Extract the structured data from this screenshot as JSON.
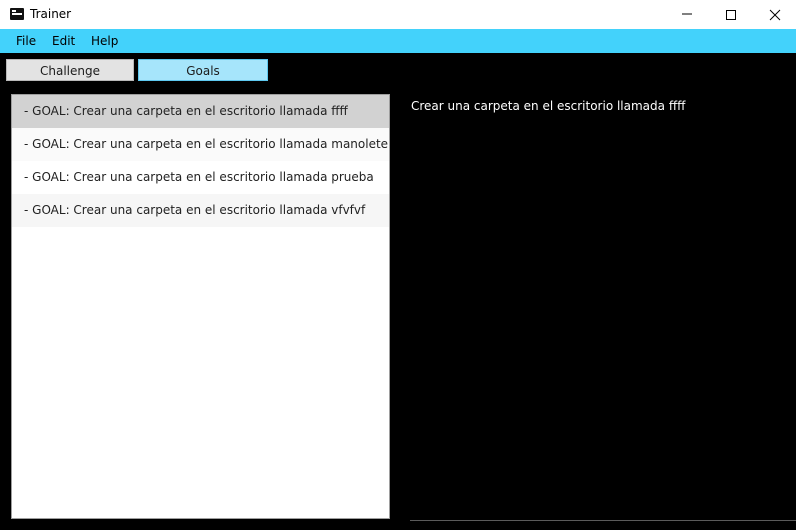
{
  "window": {
    "title": "Trainer",
    "icon": "terminal-icon",
    "controls": [
      "minimize-icon",
      "maximize-icon",
      "close-icon"
    ]
  },
  "menu": {
    "file": "File",
    "edit": "Edit",
    "help": "Help"
  },
  "tabs": {
    "challenge": "Challenge",
    "goals": "Goals",
    "selected": "Goals"
  },
  "goals": [
    "- GOAL: Crear una carpeta en el escritorio llamada ffff",
    "- GOAL: Crear una carpeta en el escritorio llamada manolete",
    "- GOAL: Crear una carpeta en el escritorio llamada prueba",
    "- GOAL: Crear una carpeta en el escritorio llamada vfvfvf"
  ],
  "selected_index": 0,
  "detail": {
    "text": "Crear una carpeta en el escritorio llamada ffff"
  },
  "colors": {
    "menubar": "#43d2fb",
    "background": "#000000",
    "selected_row": "#d2d2d2",
    "active_tab": "#a6e5fb"
  }
}
